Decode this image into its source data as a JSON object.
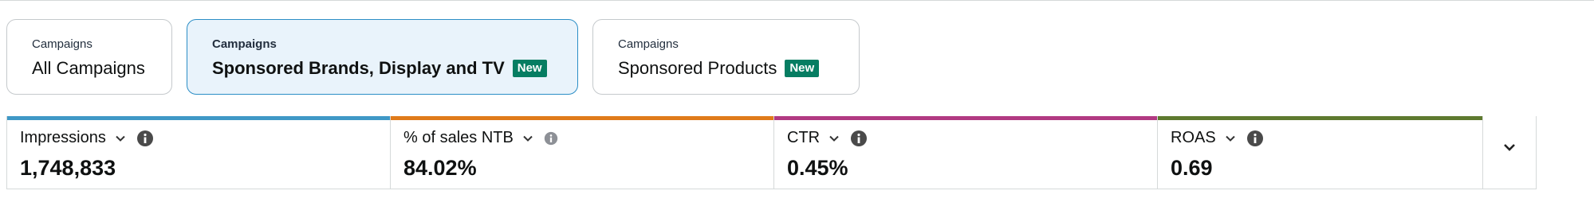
{
  "tabs": [
    {
      "kicker": "Campaigns",
      "title": "All Campaigns",
      "badge": "",
      "active": false
    },
    {
      "kicker": "Campaigns",
      "title": "Sponsored Brands, Display and TV",
      "badge": "New",
      "active": true
    },
    {
      "kicker": "Campaigns",
      "title": "Sponsored Products",
      "badge": "New",
      "active": false
    }
  ],
  "metrics": [
    {
      "label": "Impressions",
      "value": "1,748,833",
      "color": "#3f98c6",
      "info_icon": "info-icon"
    },
    {
      "label": "% of sales NTB",
      "value": "84.02%",
      "color": "#e07b1a",
      "info_icon": "info-icon"
    },
    {
      "label": "CTR",
      "value": "0.45%",
      "color": "#b13a82",
      "info_icon": "info-icon"
    },
    {
      "label": "ROAS",
      "value": "0.69",
      "color": "#5e7a2f",
      "info_icon": "info-icon"
    }
  ],
  "icons": {
    "metric_dropdown": "chevron-down-icon",
    "expand": "chevron-down-icon"
  },
  "colors": {
    "active_tab_bg": "#e9f3fb",
    "active_tab_border": "#2b8ec6",
    "badge_bg": "#067d62"
  }
}
